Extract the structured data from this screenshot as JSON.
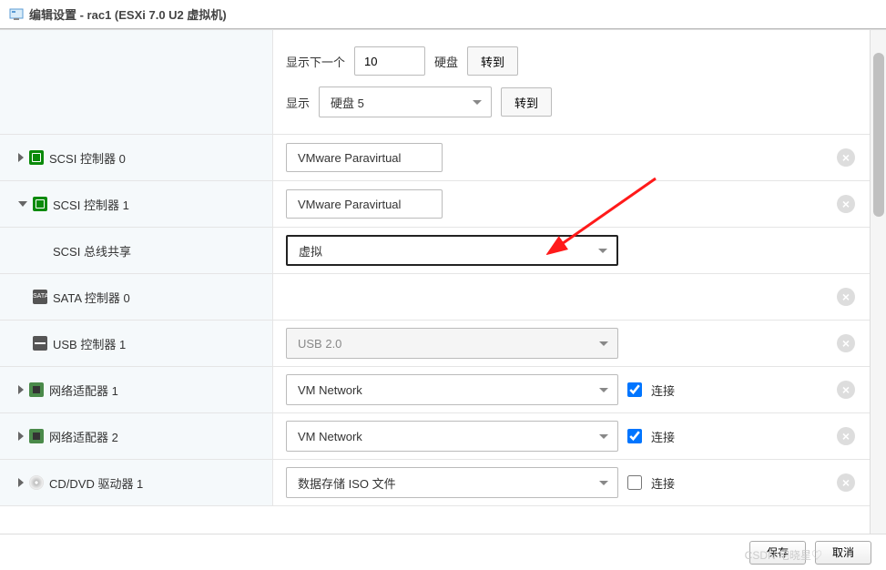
{
  "dialog": {
    "title": "编辑设置 - rac1 (ESXi 7.0 U2 虚拟机)"
  },
  "top_section": {
    "show_next_label": "显示下一个",
    "show_next_value": "10",
    "disk_label": "硬盘",
    "goto_button": "转到",
    "show_label": "显示",
    "disk_select_value": "硬盘 5"
  },
  "rows": {
    "scsi0": {
      "label": "SCSI 控制器 0",
      "value": "VMware Paravirtual"
    },
    "scsi1": {
      "label": "SCSI 控制器 1",
      "value": "VMware Paravirtual"
    },
    "scsi_bus_share": {
      "label": "SCSI 总线共享",
      "value": "虚拟"
    },
    "sata0": {
      "label": "SATA 控制器 0"
    },
    "usb1": {
      "label": "USB 控制器 1",
      "value": "USB 2.0"
    },
    "net1": {
      "label": "网络适配器 1",
      "value": "VM Network",
      "connect_label": "连接",
      "connect_checked": true
    },
    "net2": {
      "label": "网络适配器 2",
      "value": "VM Network",
      "connect_label": "连接",
      "connect_checked": true
    },
    "cddvd1": {
      "label": "CD/DVD 驱动器 1",
      "value": "数据存储 ISO 文件",
      "connect_label": "连接",
      "connect_checked": false
    }
  },
  "footer": {
    "save": "保存",
    "cancel": "取消"
  },
  "watermark": "CSDN 宅晓星♡"
}
